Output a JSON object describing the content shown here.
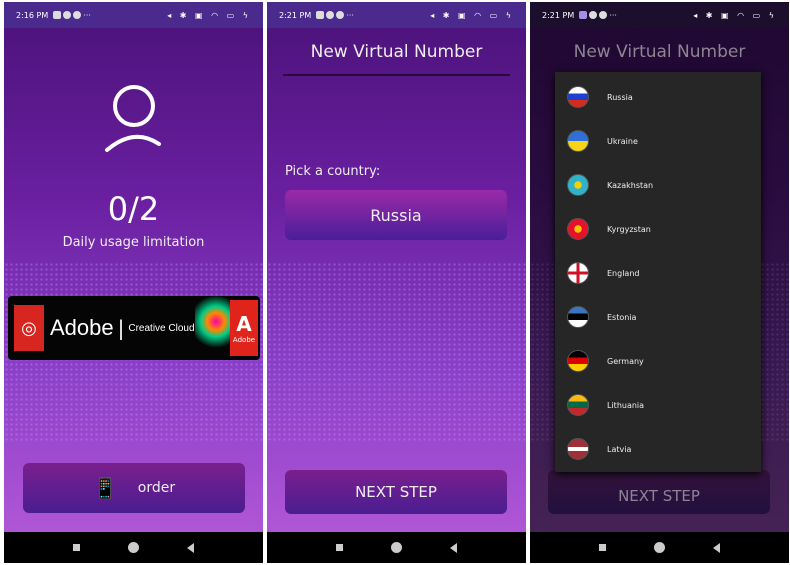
{
  "screens": [
    {
      "status": {
        "time": "2:16 PM"
      },
      "usage": {
        "count": "0/2",
        "label": "Daily usage limitation"
      },
      "ad": {
        "brand": "Adobe",
        "product": "Creative Cloud",
        "badge": "Adobe"
      },
      "order_button": {
        "label": "order",
        "icon": "sms-phone-icon"
      }
    },
    {
      "status": {
        "time": "2:21 PM"
      },
      "title": "New Virtual Number",
      "pick_label": "Pick a country:",
      "country_select": {
        "value": "Russia"
      },
      "next_button": "NEXT STEP"
    },
    {
      "status": {
        "time": "2:21 PM"
      },
      "title": "New Virtual Number",
      "next_button": "NEXT STEP",
      "countries": [
        {
          "name": "Russia",
          "flag": "linear-gradient(#fff 33%,#1c3fcf 33% 66%,#d52b1e 66%)"
        },
        {
          "name": "Ukraine",
          "flag": "linear-gradient(#2f6fd6 50%,#f7d417 50%)"
        },
        {
          "name": "Kazakhstan",
          "flag": "radial-gradient(#f5d000 25%,#2fb3c9 28%)"
        },
        {
          "name": "Kyrgyzstan",
          "flag": "radial-gradient(#f5c400 25%,#e8112d 28%)"
        },
        {
          "name": "England",
          "flag": "linear-gradient(90deg,transparent 42%,#ce1124 42% 58%,transparent 58%),linear-gradient(#fff 42%,#ce1124 42% 58%,#fff 58%)"
        },
        {
          "name": "Estonia",
          "flag": "linear-gradient(#3a75c4 33%,#000 33% 66%,#fff 66%)"
        },
        {
          "name": "Germany",
          "flag": "linear-gradient(#000 33%,#dd0000 33% 66%,#ffce00 66%)"
        },
        {
          "name": "Lithuania",
          "flag": "linear-gradient(#fdb913 33%,#006a44 33% 66%,#c1272d 66%)"
        },
        {
          "name": "Latvia",
          "flag": "linear-gradient(#9e3039 40%,#fff 40% 60%,#9e3039 60%)"
        }
      ]
    }
  ],
  "status_icons": "◂ ✱ ▣ ◠ ▭ ϟ"
}
